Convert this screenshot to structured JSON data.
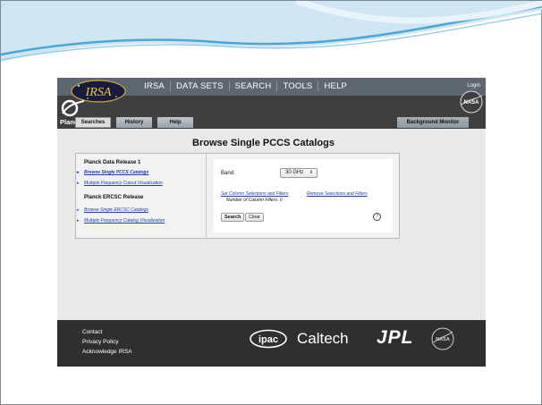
{
  "branding": {
    "irsa_logo_text": "IRSA",
    "planck_text": "Planck",
    "nasa_text": "NASA"
  },
  "nav": {
    "items": [
      "IRSA",
      "DATA SETS",
      "SEARCH",
      "TOOLS",
      "HELP"
    ],
    "login": "Login"
  },
  "tabs": {
    "searches": "Searches",
    "history": "History",
    "help": "Help",
    "background_monitor": "Background Monitor"
  },
  "page": {
    "title": "Browse Single PCCS Catalogs"
  },
  "sidebar": {
    "section1_title": "Planck Data Release 1",
    "section1_links": [
      "Browse Single PCCS Catalogs",
      "Multiple Frequency Cutout Visualization"
    ],
    "section2_title": "Planck ERCSC Release",
    "section2_links": [
      "Browse Single ERCSC Catalogs",
      "Multiple Frequency Catalog Visualization"
    ]
  },
  "form": {
    "band_label": "Band:",
    "band_value": "30 GHz",
    "set_columns_link": "Set Column Selections and Filters",
    "remove_link": "Remove Selections and Filters",
    "filters_text": "Number of Column Filters: 0",
    "search_button": "Search",
    "clear_button": "Clear",
    "help_icon": "?"
  },
  "footer": {
    "links": [
      "Contact",
      "Privacy Policy",
      "Acknowledge IRSA"
    ],
    "ipac_text": "ipac",
    "caltech_text": "Caltech",
    "jpl_text": "JPL",
    "nasa_text": "NASA"
  },
  "colors": {
    "nav_bar": "#5c6773",
    "sub_bar": "#3f3f3f",
    "footer": "#2f2f2f",
    "link": "#1b3fa8",
    "swoosh": "#4aa6d6"
  }
}
